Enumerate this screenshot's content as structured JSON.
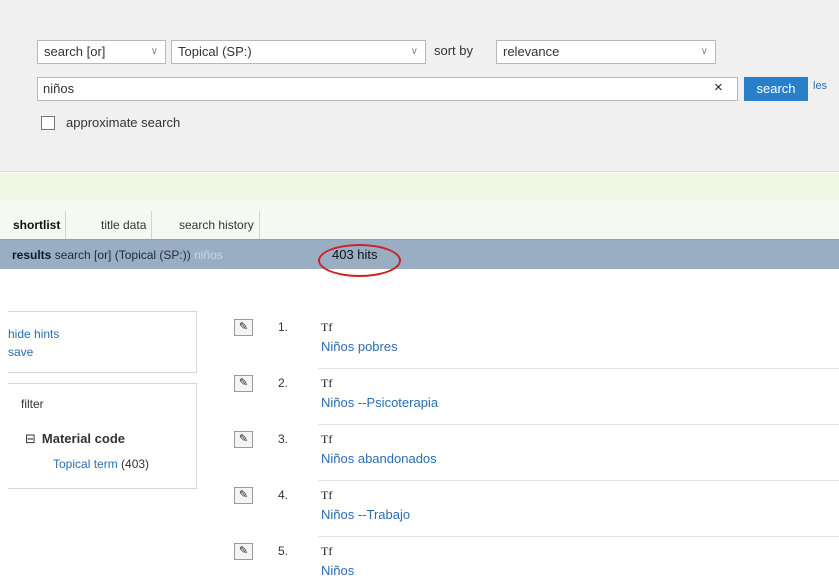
{
  "search": {
    "operator": "search [or]",
    "field": "Topical (SP:)",
    "sort_label": "sort by",
    "sort_value": "relevance",
    "query": "niños",
    "clear_symbol": "×",
    "search_button": "search",
    "less_link": "les",
    "approximate_label": "approximate search"
  },
  "tabs": [
    "shortlist",
    "title data",
    "search history"
  ],
  "results_bar": {
    "label": "results",
    "description": "search [or] (Topical (SP:))",
    "term": "niños",
    "hits": "403 hits"
  },
  "hints": {
    "hide": "hide hints",
    "save": "save"
  },
  "filter": {
    "label": "filter",
    "group_toggle": "⊟",
    "group": "Material code",
    "item": "Topical term",
    "item_count": "(403)"
  },
  "results": [
    {
      "num": "1.",
      "type": "Tf",
      "title": "Niños pobres"
    },
    {
      "num": "2.",
      "type": "Tf",
      "title": "Niños --Psicoterapia"
    },
    {
      "num": "3.",
      "type": "Tf",
      "title": "Niños abandonados"
    },
    {
      "num": "4.",
      "type": "Tf",
      "title": "Niños --Trabajo"
    },
    {
      "num": "5.",
      "type": "Tf",
      "title": "Niños"
    }
  ],
  "colors": {
    "accent": "#2a7fc9",
    "link": "#2a6db5",
    "results_bar": "#9aaec3",
    "highlight_circle": "#cc2222"
  },
  "icons": {
    "record": "record-icon",
    "chevron": "chevron-down-icon",
    "clear": "close-icon"
  }
}
